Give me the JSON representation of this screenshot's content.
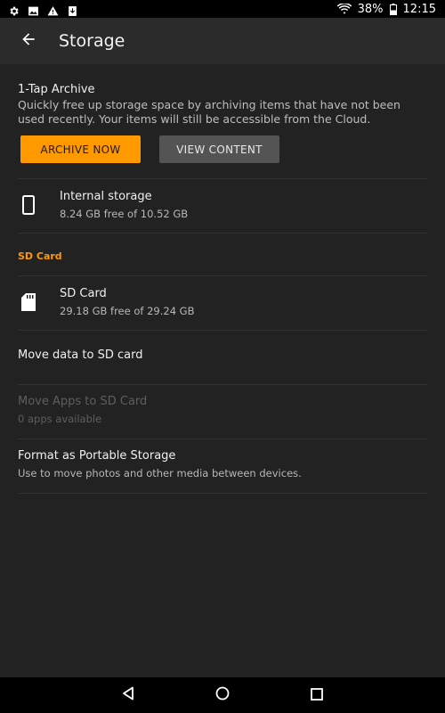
{
  "status_bar": {
    "battery": "38%",
    "time": "12:15",
    "icons": [
      "gear-icon",
      "image-icon",
      "warning-icon",
      "download-icon",
      "wifi-icon",
      "battery-icon"
    ]
  },
  "toolbar": {
    "title": "Storage",
    "back_icon": "arrow-back-icon"
  },
  "archive": {
    "title": "1-Tap Archive",
    "description": "Quickly free up storage space by archiving items that have not been used recently. Your items will still be accessible from the Cloud.",
    "archive_now_label": "ARCHIVE NOW",
    "view_content_label": "VIEW CONTENT"
  },
  "internal_storage": {
    "title": "Internal storage",
    "subtitle": "8.24 GB free of 10.52 GB",
    "icon": "phone-icon"
  },
  "sd_section": {
    "header": "SD Card"
  },
  "sd_card": {
    "title": "SD Card",
    "subtitle": "29.18 GB free of 29.24 GB",
    "icon": "sd-card-icon"
  },
  "move_data": {
    "title": "Move data to SD card"
  },
  "move_apps": {
    "title": "Move Apps to SD Card",
    "subtitle": "0 apps available"
  },
  "format": {
    "title": "Format as Portable Storage",
    "subtitle": "Use to move photos and other media between devices."
  },
  "nav_bar": {
    "icons": [
      "back-triangle-icon",
      "home-circle-icon",
      "recents-square-icon"
    ]
  },
  "colors": {
    "accent": "#ff9900",
    "background": "#222222",
    "toolbar": "#2b2b2b",
    "secondary_button": "#545454"
  }
}
